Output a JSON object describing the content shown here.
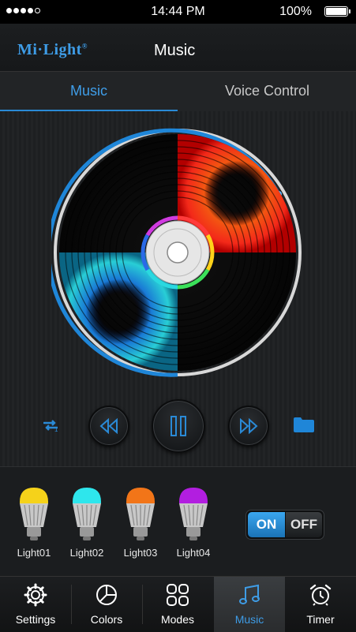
{
  "status_bar": {
    "time": "14:44 PM",
    "battery": "100%"
  },
  "header": {
    "logo": "Mi·Light",
    "logo_mark": "®",
    "title": "Music"
  },
  "tabs": [
    {
      "label": "Music",
      "active": true
    },
    {
      "label": "Voice Control",
      "active": false
    }
  ],
  "player": {
    "state": "playing",
    "ring_color": "#2a8ad6"
  },
  "lights": [
    {
      "label": "Light01",
      "color": "#f5d21a"
    },
    {
      "label": "Light02",
      "color": "#2ee6ec"
    },
    {
      "label": "Light03",
      "color": "#f27518"
    },
    {
      "label": "Light04",
      "color": "#b21ee0"
    }
  ],
  "power_toggle": {
    "on_label": "ON",
    "off_label": "OFF",
    "state": "on"
  },
  "tab_bar": [
    {
      "label": "Settings",
      "icon": "gear-icon",
      "active": false
    },
    {
      "label": "Colors",
      "icon": "pie-chart-icon",
      "active": false
    },
    {
      "label": "Modes",
      "icon": "grid-icon",
      "active": false
    },
    {
      "label": "Music",
      "icon": "music-note-icon",
      "active": true
    },
    {
      "label": "Timer",
      "icon": "alarm-clock-icon",
      "active": false
    }
  ],
  "accent_color": "#3e9ce6"
}
